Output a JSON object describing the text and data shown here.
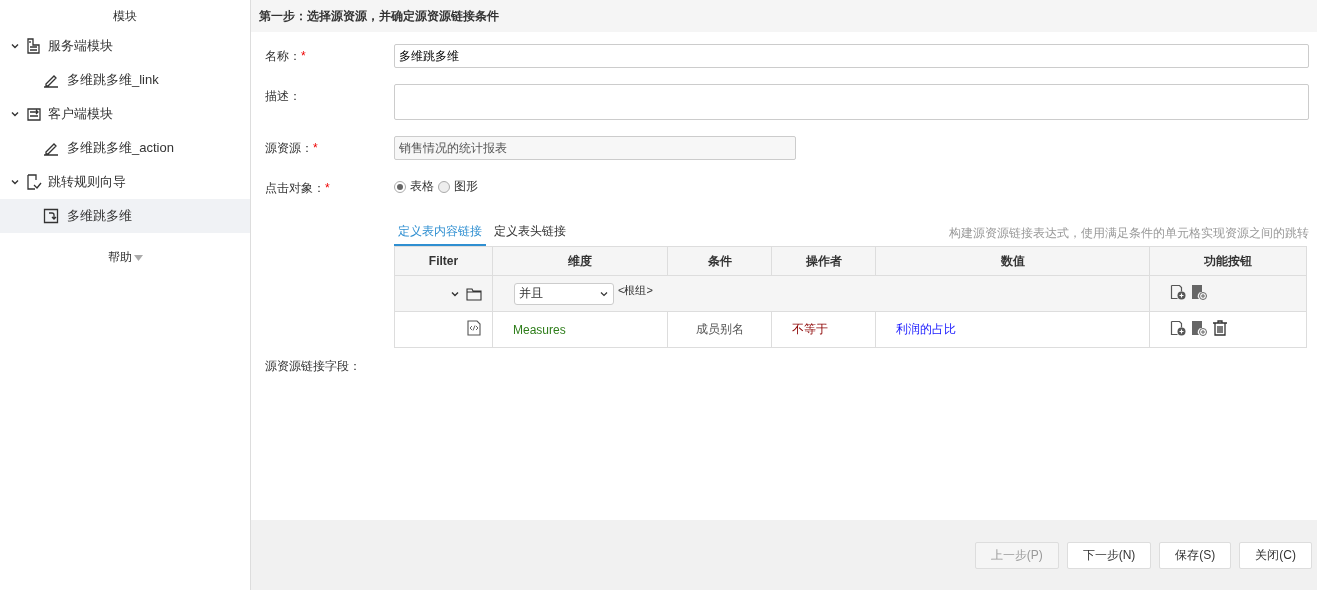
{
  "sidebar": {
    "header": "模块",
    "tree": [
      {
        "label": "服务端模块",
        "kind": "server",
        "expanded": true,
        "children": [
          {
            "label": "多维跳多维_link",
            "kind": "link",
            "selected": false
          }
        ]
      },
      {
        "label": "客户端模块",
        "kind": "client",
        "expanded": true,
        "children": [
          {
            "label": "多维跳多维_action",
            "kind": "link",
            "selected": false
          }
        ]
      },
      {
        "label": "跳转规则向导",
        "kind": "wizard",
        "expanded": true,
        "children": [
          {
            "label": "多维跳多维",
            "kind": "jump",
            "selected": true
          }
        ]
      }
    ],
    "help": "帮助"
  },
  "step_title": "第一步：选择源资源，并确定源资源链接条件",
  "form": {
    "name": {
      "label": "名称：",
      "required_mark": "*",
      "value": "多维跳多维"
    },
    "description": {
      "label": "描述："
    },
    "source": {
      "label": "源资源：",
      "required_mark": "*",
      "value": "销售情况的统计报表"
    },
    "click_target": {
      "label": "点击对象：",
      "required_mark": "*",
      "options": [
        {
          "label": "表格",
          "selected": true
        },
        {
          "label": "图形",
          "selected": false
        }
      ]
    }
  },
  "tabs": [
    {
      "label": "定义表内容链接",
      "selected": true
    },
    {
      "label": "定义表头链接",
      "selected": false
    }
  ],
  "hint": "构建源资源链接表达式，使用满足条件的单元格实现资源之间的跳转",
  "table": {
    "columns": [
      "Filter",
      "维度",
      "条件",
      "操作者",
      "数值",
      "功能按钮"
    ],
    "rows": [
      {
        "kind": "group",
        "expanded": true,
        "logic": "并且",
        "group_label": "<根组>",
        "actions": [
          {
            "kind": "add-condition"
          },
          {
            "kind": "add-group"
          }
        ]
      },
      {
        "kind": "condition",
        "dimension": "Measures",
        "condition": "成员别名",
        "operator": "不等于",
        "value": "利润的占比",
        "actions": [
          {
            "kind": "add-condition"
          },
          {
            "kind": "add-group"
          },
          {
            "kind": "delete"
          }
        ]
      }
    ]
  },
  "link_fields_label": "源资源链接字段：",
  "buttons": [
    {
      "label": "上一步(P)",
      "disabled": true
    },
    {
      "label": "下一步(N)",
      "disabled": false
    },
    {
      "label": "保存(S)",
      "disabled": false
    },
    {
      "label": "关闭(C)",
      "disabled": false
    }
  ]
}
